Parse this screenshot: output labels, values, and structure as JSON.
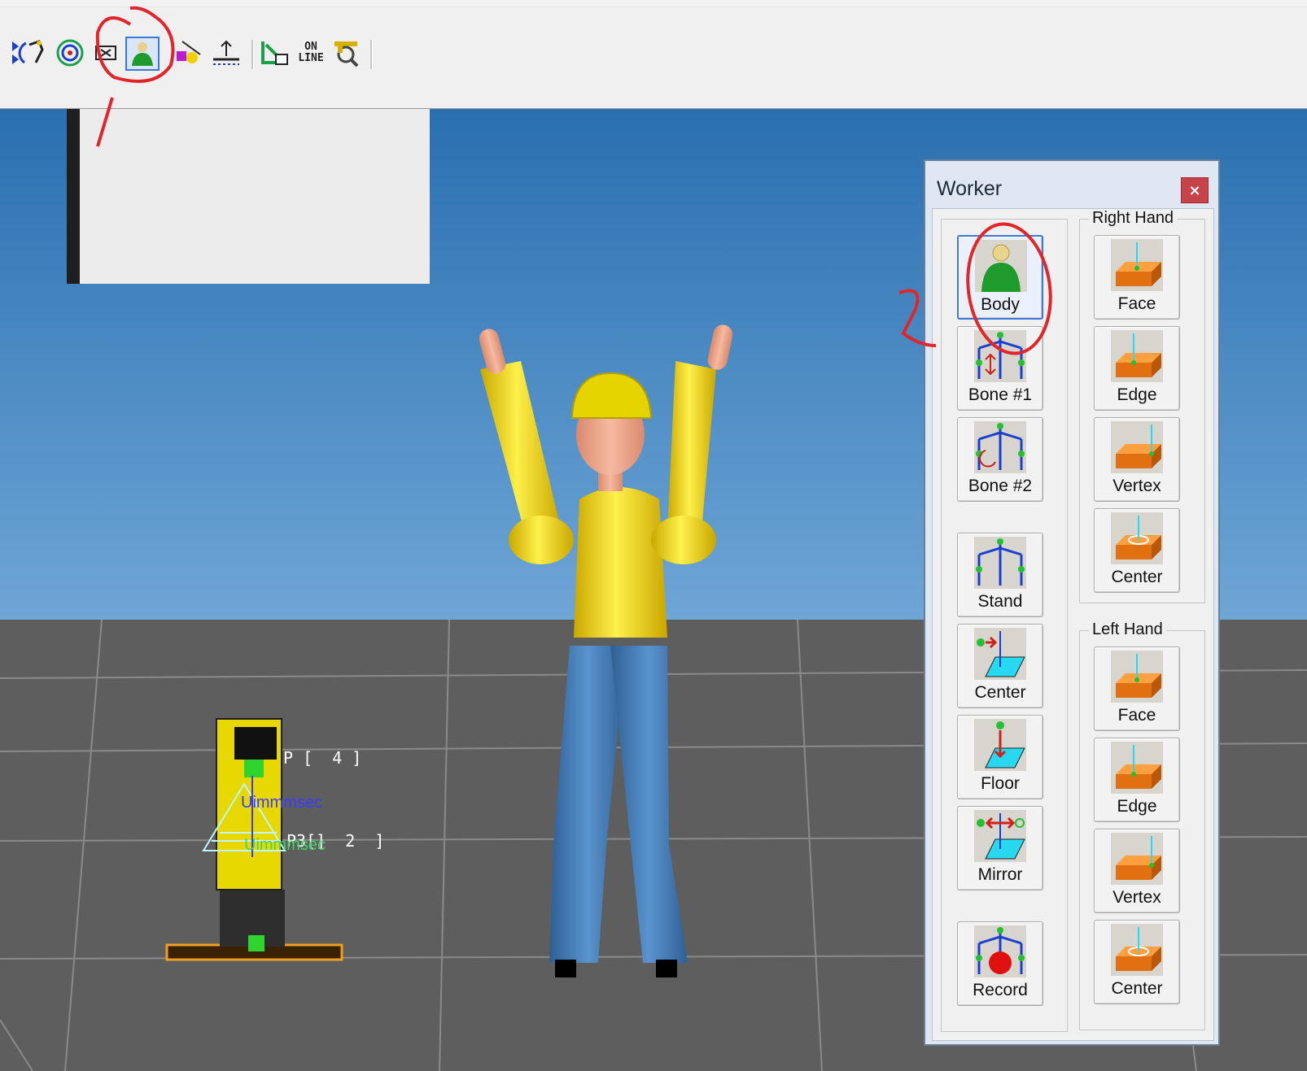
{
  "toolbar": {
    "online_label_line1": "ON",
    "online_label_line2": "LINE",
    "icons": [
      "move-arrows-icon",
      "robot-arm-rotate-icon",
      "target-icon",
      "frame-icon",
      "worker-icon",
      "shape-tool-icon",
      "measure-icon",
      "teach-icon",
      "online-icon",
      "inspect-icon"
    ],
    "active_icon": "worker-icon"
  },
  "viewport": {
    "labels": {
      "p4": "P [  4 ]",
      "p2": "P3[]  2  ]",
      "timer1": "Uimmmsec",
      "timer2": "Uimmmsec"
    },
    "colors": {
      "sky_top": "#2a6fb0",
      "sky_bottom": "#6ea6d6",
      "floor": "#5e5e5e",
      "grid": "#8a8a8a"
    }
  },
  "worker_panel": {
    "title": "Worker",
    "close_label": "×",
    "left_buttons": [
      {
        "label": "Body",
        "icon": "body-icon",
        "active": true
      },
      {
        "label": "Bone #1",
        "icon": "bone-translate-icon"
      },
      {
        "label": "Bone #2",
        "icon": "bone-rotate-icon"
      },
      {
        "label": "Stand",
        "icon": "stand-icon"
      },
      {
        "label": "Center",
        "icon": "center-plane-icon"
      },
      {
        "label": "Floor",
        "icon": "floor-icon"
      },
      {
        "label": "Mirror",
        "icon": "mirror-icon"
      },
      {
        "label": "Record",
        "icon": "record-icon"
      }
    ],
    "right_hand": {
      "title": "Right Hand",
      "buttons": [
        {
          "label": "Face",
          "icon": "face-icon"
        },
        {
          "label": "Edge",
          "icon": "edge-icon"
        },
        {
          "label": "Vertex",
          "icon": "vertex-icon"
        },
        {
          "label": "Center",
          "icon": "center-icon"
        }
      ]
    },
    "left_hand": {
      "title": "Left Hand",
      "buttons": [
        {
          "label": "Face",
          "icon": "face-icon"
        },
        {
          "label": "Edge",
          "icon": "edge-icon"
        },
        {
          "label": "Vertex",
          "icon": "vertex-icon"
        },
        {
          "label": "Center",
          "icon": "center-icon"
        }
      ]
    }
  },
  "annotations": {
    "marker1": "1",
    "marker2": "2",
    "color": "#e0262b"
  }
}
